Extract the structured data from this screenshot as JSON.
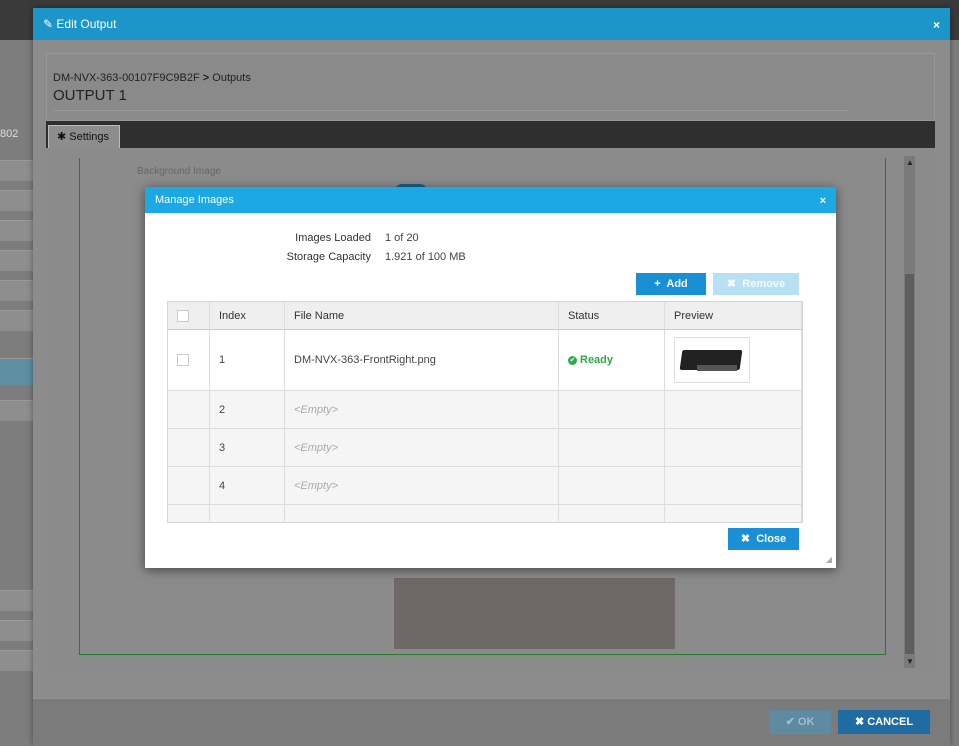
{
  "edit_dialog": {
    "title": "Edit Output",
    "close_label": "×",
    "breadcrumb_device": "DM-NVX-363-00107F9C9B2F",
    "breadcrumb_sep": ">",
    "breadcrumb_section": "Outputs",
    "output_title": "OUTPUT 1",
    "tab_settings": "Settings",
    "bg_image_label": "Background Image",
    "ok_label": "OK",
    "cancel_label": "CANCEL"
  },
  "background": {
    "side_label": "802"
  },
  "manage_images": {
    "title": "Manage Images",
    "close_x": "×",
    "images_loaded_label": "Images Loaded",
    "images_loaded_value": "1 of 20",
    "storage_label": "Storage Capacity",
    "storage_value": "1.921 of 100 MB",
    "add_label": "Add",
    "remove_label": "Remove",
    "close_label": "Close",
    "columns": [
      "Index",
      "File Name",
      "Status",
      "Preview"
    ],
    "rows": [
      {
        "index": "1",
        "file_name": "DM-NVX-363-FrontRight.png",
        "status": "Ready"
      },
      {
        "index": "2",
        "file_name": "<Empty>",
        "status": ""
      },
      {
        "index": "3",
        "file_name": "<Empty>",
        "status": ""
      },
      {
        "index": "4",
        "file_name": "<Empty>",
        "status": ""
      }
    ]
  },
  "colors": {
    "accent": "#1ca8e3",
    "ready": "#2da84a",
    "title_bar": "#1c95c9"
  }
}
